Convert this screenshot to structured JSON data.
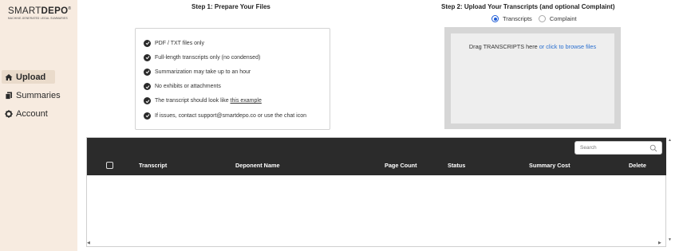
{
  "brand": {
    "name_light": "SMART",
    "name_bold": "DEPO",
    "registered": "®",
    "tagline": "MACHINE-GENERATED LEGAL SUMMARIES"
  },
  "sidebar": {
    "items": [
      {
        "label": "Upload",
        "icon": "home-icon",
        "active": true
      },
      {
        "label": "Summaries",
        "icon": "file-copy-icon",
        "active": false
      },
      {
        "label": "Account",
        "icon": "gear-icon",
        "active": false
      }
    ]
  },
  "step1": {
    "title": "Step 1: Prepare Your Files",
    "checklist": [
      "PDF / TXT files only",
      "Full-length transcripts only (no condensed)",
      "Summarization may take up to an hour",
      "No exhibits or attachments",
      "The transcript should look like ",
      "If issues, contact support@smartdepo.co or use the chat icon"
    ],
    "example_link": "this example"
  },
  "step2": {
    "title": "Step 2: Upload Your Transcripts (and optional Complaint)",
    "radio_options": [
      {
        "label": "Transcripts",
        "selected": true
      },
      {
        "label": "Complaint",
        "selected": false
      }
    ],
    "dropzone_text": "Drag TRANSCRIPTS here ",
    "dropzone_link": "or click to browse files"
  },
  "table": {
    "search_placeholder": "Search",
    "columns": [
      "Transcript",
      "Deponent Name",
      "Page Count",
      "Status",
      "Summary Cost",
      "Delete"
    ],
    "rows": []
  },
  "colors": {
    "sidebar_bg": "#f7ebe0",
    "active_nav_bg": "#eadbcb",
    "table_header_bg": "#2b2b2b",
    "link": "#2a6fcf",
    "radio_selected": "#1e5cd6"
  }
}
